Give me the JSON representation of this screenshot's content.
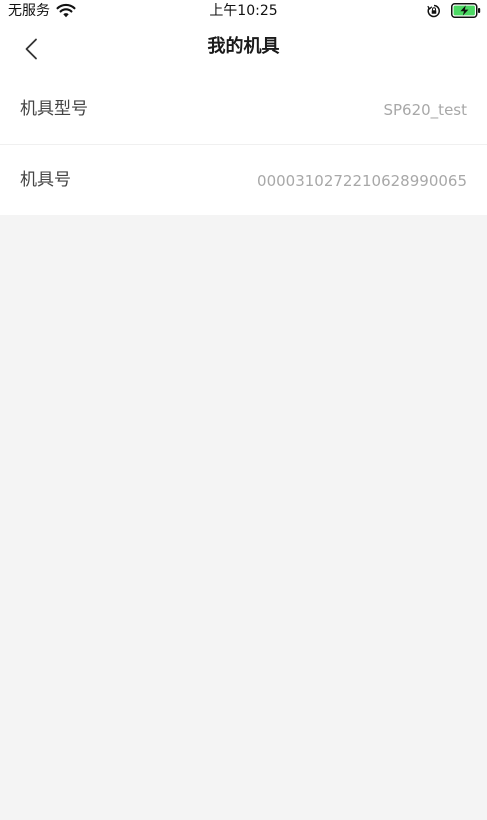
{
  "status_bar": {
    "carrier": "无服务",
    "time": "上午10:25",
    "icons": [
      "wifi-icon",
      "orientation-lock-icon",
      "battery-charging-icon"
    ]
  },
  "nav": {
    "back_icon": "chevron-left-icon",
    "title": "我的机具"
  },
  "device_info": {
    "rows": [
      {
        "label": "机具型号",
        "value": "SP620_test"
      },
      {
        "label": "机具号",
        "value": "0000310272210628990065"
      }
    ]
  },
  "colors": {
    "background": "#f4f4f4",
    "card": "#ffffff",
    "value_text": "#a8a8a8",
    "battery_green": "#4cd964"
  }
}
